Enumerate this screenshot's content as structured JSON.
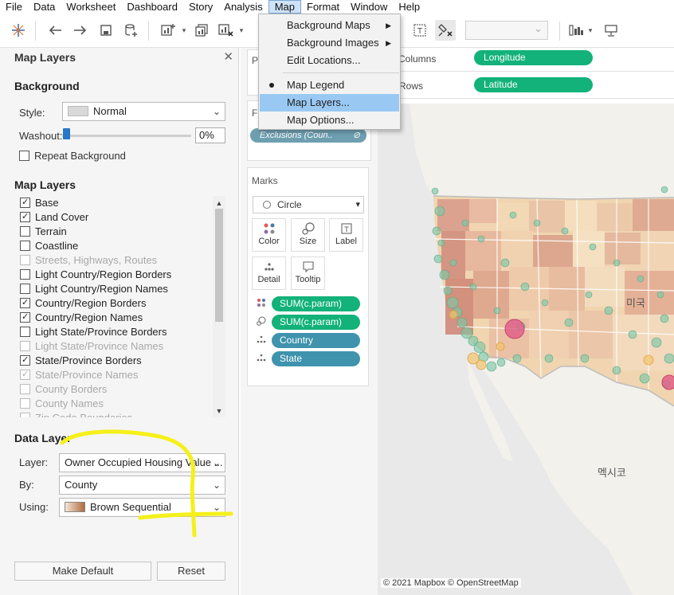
{
  "menubar": {
    "items": [
      "File",
      "Data",
      "Worksheet",
      "Dashboard",
      "Story",
      "Analysis",
      "Map",
      "Format",
      "Window",
      "Help"
    ],
    "active": "Map"
  },
  "map_menu": {
    "items": [
      {
        "label": "Background Maps",
        "submenu": true
      },
      {
        "label": "Background Images",
        "submenu": true
      },
      {
        "label": "Edit Locations...",
        "submenu": false
      },
      {
        "label": "Map Legend",
        "checked": true
      },
      {
        "label": "Map Layers...",
        "highlighted": true
      },
      {
        "label": "Map Options..."
      }
    ]
  },
  "map_layers_panel": {
    "title": "Map Layers",
    "background": {
      "heading": "Background",
      "style_label": "Style:",
      "style_value": "Normal",
      "washout_label": "Washout:",
      "washout_value": "0%",
      "washout_fraction": 0,
      "repeat_label": "Repeat Background",
      "repeat_checked": false
    },
    "layers": {
      "heading": "Map Layers",
      "items": [
        {
          "label": "Base",
          "checked": true,
          "enabled": true
        },
        {
          "label": "Land Cover",
          "checked": true,
          "enabled": true
        },
        {
          "label": "Terrain",
          "checked": false,
          "enabled": true
        },
        {
          "label": "Coastline",
          "checked": false,
          "enabled": true
        },
        {
          "label": "Streets, Highways, Routes",
          "checked": false,
          "enabled": false
        },
        {
          "label": "Light Country/Region Borders",
          "checked": false,
          "enabled": true
        },
        {
          "label": "Light Country/Region Names",
          "checked": false,
          "enabled": true
        },
        {
          "label": "Country/Region Borders",
          "checked": true,
          "enabled": true
        },
        {
          "label": "Country/Region Names",
          "checked": true,
          "enabled": true
        },
        {
          "label": "Light State/Province Borders",
          "checked": false,
          "enabled": true
        },
        {
          "label": "Light State/Province Names",
          "checked": false,
          "enabled": false
        },
        {
          "label": "State/Province Borders",
          "checked": true,
          "enabled": true
        },
        {
          "label": "State/Province Names",
          "checked": true,
          "enabled": false
        },
        {
          "label": "County Borders",
          "checked": false,
          "enabled": false
        },
        {
          "label": "County Names",
          "checked": false,
          "enabled": false
        },
        {
          "label": "Zip Code Boundaries",
          "checked": false,
          "enabled": false
        }
      ]
    },
    "data_layer": {
      "heading": "Data Layer",
      "layer_label": "Layer:",
      "layer_value": "Owner Occupied Housing Value ...",
      "by_label": "By:",
      "by_value": "County",
      "using_label": "Using:",
      "using_value": "Brown Sequential"
    },
    "make_default": "Make Default",
    "reset": "Reset"
  },
  "cards": {
    "pages_caption": "Pa",
    "filters_caption": "Fi",
    "filter_pill": "Exclusions (Coun..",
    "marks_caption": "Marks",
    "marks_type": "Circle",
    "mark_buttons": [
      "Color",
      "Size",
      "Label",
      "Detail",
      "Tooltip"
    ],
    "mark_pills": [
      {
        "label": "SUM(c.param)",
        "kind": "color"
      },
      {
        "label": "SUM(c.param)",
        "kind": "size"
      },
      {
        "label": "Country",
        "kind": "detail"
      },
      {
        "label": "State",
        "kind": "detail"
      }
    ]
  },
  "shelves": {
    "columns_label": "Columns",
    "columns_pill": "Longitude",
    "rows_label": "Rows",
    "rows_pill": "Latitude"
  },
  "map": {
    "labels": [
      "미국",
      "멕시코"
    ],
    "credit": "© 2021 Mapbox © OpenStreetMap"
  }
}
